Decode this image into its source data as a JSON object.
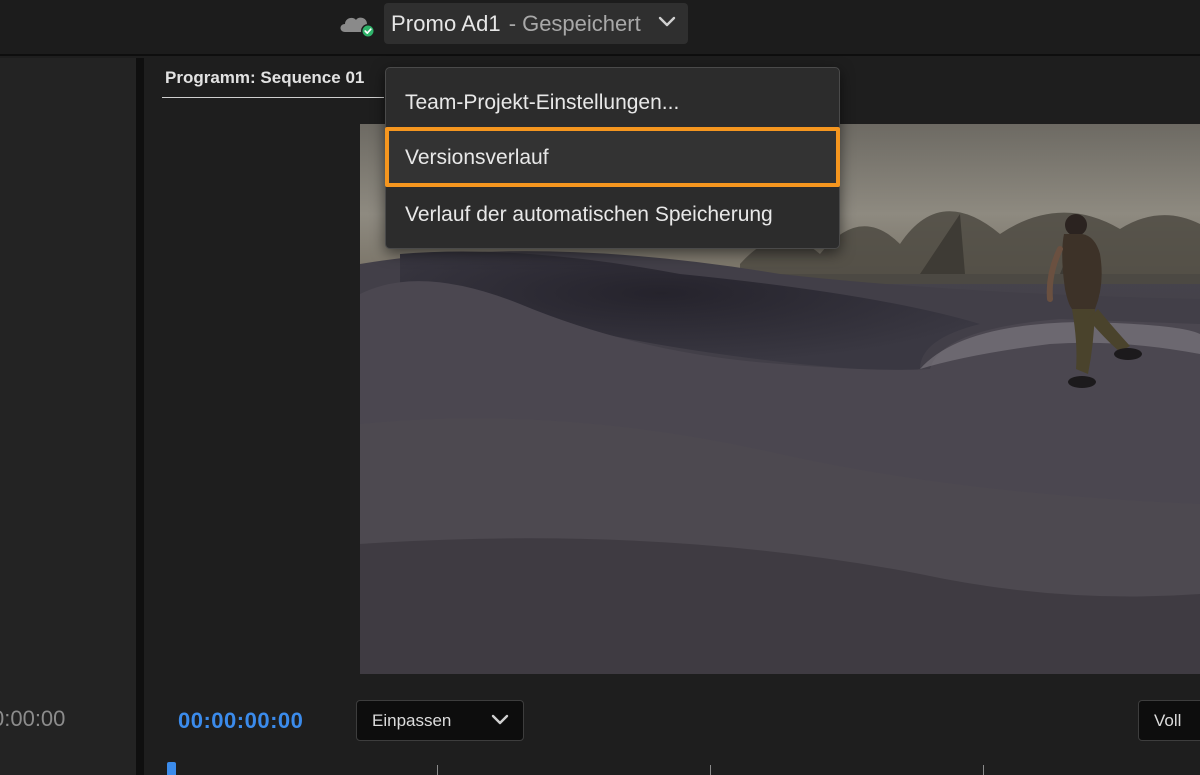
{
  "header": {
    "project_name": "Promo Ad1",
    "separator": "-",
    "save_status": "Gespeichert",
    "cloud_status_icon": "cloud-check-icon",
    "status_color": "#2fb36a"
  },
  "left_panel": {
    "timecode": "0:00:00"
  },
  "monitor": {
    "tab_label": "Programm: Sequence 01",
    "current_timecode": "00:00:00:00",
    "timecode_color": "#3b8beb",
    "zoom_value": "Einpassen",
    "quality_value": "Voll"
  },
  "menu": {
    "items": [
      {
        "label": "Team-Projekt-Einstellungen..."
      },
      {
        "label": "Versionsverlauf",
        "highlighted": true
      },
      {
        "label": "Verlauf der automatischen Speicherung"
      }
    ],
    "highlight_color": "#f5961f"
  }
}
